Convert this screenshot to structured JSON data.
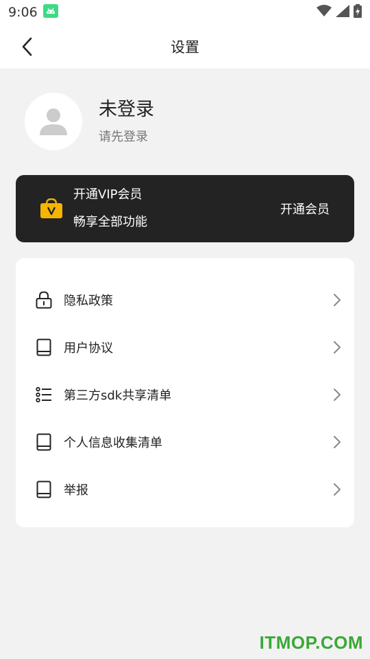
{
  "status_bar": {
    "time": "9:06",
    "icons": [
      "android-icon",
      "wifi-icon",
      "signal-icon",
      "battery-icon"
    ]
  },
  "app_bar": {
    "back_icon": "back-arrow-icon",
    "title": "设置"
  },
  "profile": {
    "avatar_icon": "user-avatar-icon",
    "name": "未登录",
    "subtitle": "请先登录"
  },
  "vip": {
    "icon": "vip-bag-icon",
    "title": "开通VIP会员",
    "subtitle": "畅享全部功能",
    "button_label": "开通会员",
    "accent_color": "#f5b400",
    "card_color": "#232323"
  },
  "menu": {
    "items": [
      {
        "label": "隐私政策",
        "icon": "lock-icon"
      },
      {
        "label": "用户协议",
        "icon": "book-icon"
      },
      {
        "label": "第三方sdk共享清单",
        "icon": "list-icon"
      },
      {
        "label": "个人信息收集清单",
        "icon": "book-icon"
      },
      {
        "label": "举报",
        "icon": "book-icon"
      }
    ]
  },
  "watermark": "ITMOP.COM"
}
